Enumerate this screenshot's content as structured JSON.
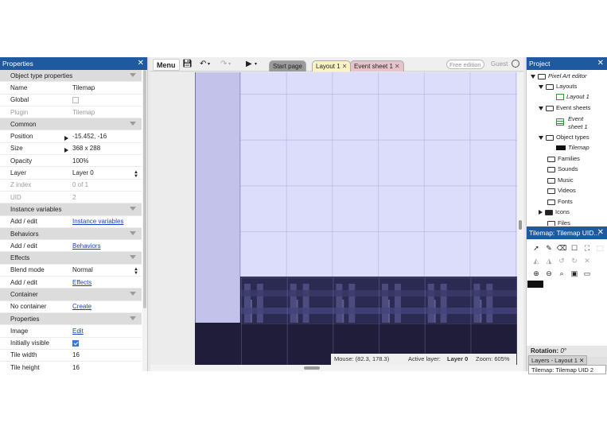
{
  "properties_panel": {
    "title": "Properties",
    "rows": [
      {
        "type": "category",
        "label": "Object type properties"
      },
      {
        "type": "prop",
        "key": "Name",
        "value": "Tilemap"
      },
      {
        "type": "check",
        "key": "Global",
        "checked": false
      },
      {
        "type": "prop",
        "key": "Plugin",
        "value": "Tilemap",
        "disabled": true
      },
      {
        "type": "category",
        "label": "Common"
      },
      {
        "type": "prop",
        "key": "Position",
        "value": "-15.452, -16",
        "expandable": true
      },
      {
        "type": "prop",
        "key": "Size",
        "value": "368 x 288",
        "expandable": true
      },
      {
        "type": "prop",
        "key": "Opacity",
        "value": "100%"
      },
      {
        "type": "select",
        "key": "Layer",
        "value": "Layer 0"
      },
      {
        "type": "prop",
        "key": "Z index",
        "value": "0 of 1",
        "disabled": true
      },
      {
        "type": "prop",
        "key": "UID",
        "value": "2",
        "disabled": true
      },
      {
        "type": "category",
        "label": "Instance variables"
      },
      {
        "type": "link",
        "key": "Add / edit",
        "value": "Instance variables"
      },
      {
        "type": "category",
        "label": "Behaviors"
      },
      {
        "type": "link",
        "key": "Add / edit",
        "value": "Behaviors"
      },
      {
        "type": "category",
        "label": "Effects"
      },
      {
        "type": "select",
        "key": "Blend mode",
        "value": "Normal"
      },
      {
        "type": "link",
        "key": "Add / edit",
        "value": "Effects"
      },
      {
        "type": "category",
        "label": "Container"
      },
      {
        "type": "link",
        "key": "No container",
        "value": "Create"
      },
      {
        "type": "category",
        "label": "Properties"
      },
      {
        "type": "link",
        "key": "Image",
        "value": "Edit"
      },
      {
        "type": "check",
        "key": "Initially visible",
        "checked": true
      },
      {
        "type": "prop",
        "key": "Tile width",
        "value": "16"
      },
      {
        "type": "prop",
        "key": "Tile height",
        "value": "16"
      }
    ]
  },
  "toolbar": {
    "menu_label": "Menu",
    "tabs": [
      {
        "label": "Start page",
        "color": "#9a9a9a"
      },
      {
        "label": "Layout 1",
        "color": "#fbf3c4"
      },
      {
        "label": "Event sheet 1",
        "color": "#e7c4c9"
      }
    ],
    "free_edition": "Free edition",
    "guest": "Guest"
  },
  "status_bar": {
    "mouse": "Mouse: (82.3, 178.3)",
    "active_layer_label": "Active layer:",
    "active_layer": "Layer 0",
    "zoom": "Zoom: 605%"
  },
  "project_panel": {
    "title": "Project",
    "items": [
      {
        "label": "Pixel Art editor",
        "icon": "folder-icon"
      },
      {
        "label": "Layouts",
        "icon": "folder-icon"
      },
      {
        "label": "Layout 1",
        "icon": "layout-icon"
      },
      {
        "label": "Event sheets",
        "icon": "folder-icon"
      },
      {
        "label": "Event sheet 1",
        "icon": "event-sheet-icon"
      },
      {
        "label": "Object types",
        "icon": "folder-icon"
      },
      {
        "label": "Tilemap",
        "icon": "tilemap-icon"
      },
      {
        "label": "Families",
        "icon": "folder-icon"
      },
      {
        "label": "Sounds",
        "icon": "folder-icon"
      },
      {
        "label": "Music",
        "icon": "folder-icon"
      },
      {
        "label": "Videos",
        "icon": "folder-icon"
      },
      {
        "label": "Fonts",
        "icon": "folder-icon"
      },
      {
        "label": "Icons",
        "icon": "folder-icon"
      },
      {
        "label": "Files",
        "icon": "folder-icon"
      }
    ]
  },
  "tilemap_panel": {
    "title": "Tilemap: Tilemap UID...",
    "rotation_label": "Rotation:",
    "rotation_value": "0°",
    "bottom_tabs": [
      "Layers - Layout 1",
      "Tilemap: Tilemap UID 2"
    ]
  },
  "colors": {
    "panel_title": "#1f5aa0",
    "sky": "#dcdcfb",
    "tile_dark": "#1f1d3a",
    "link": "#1a3fc4"
  }
}
